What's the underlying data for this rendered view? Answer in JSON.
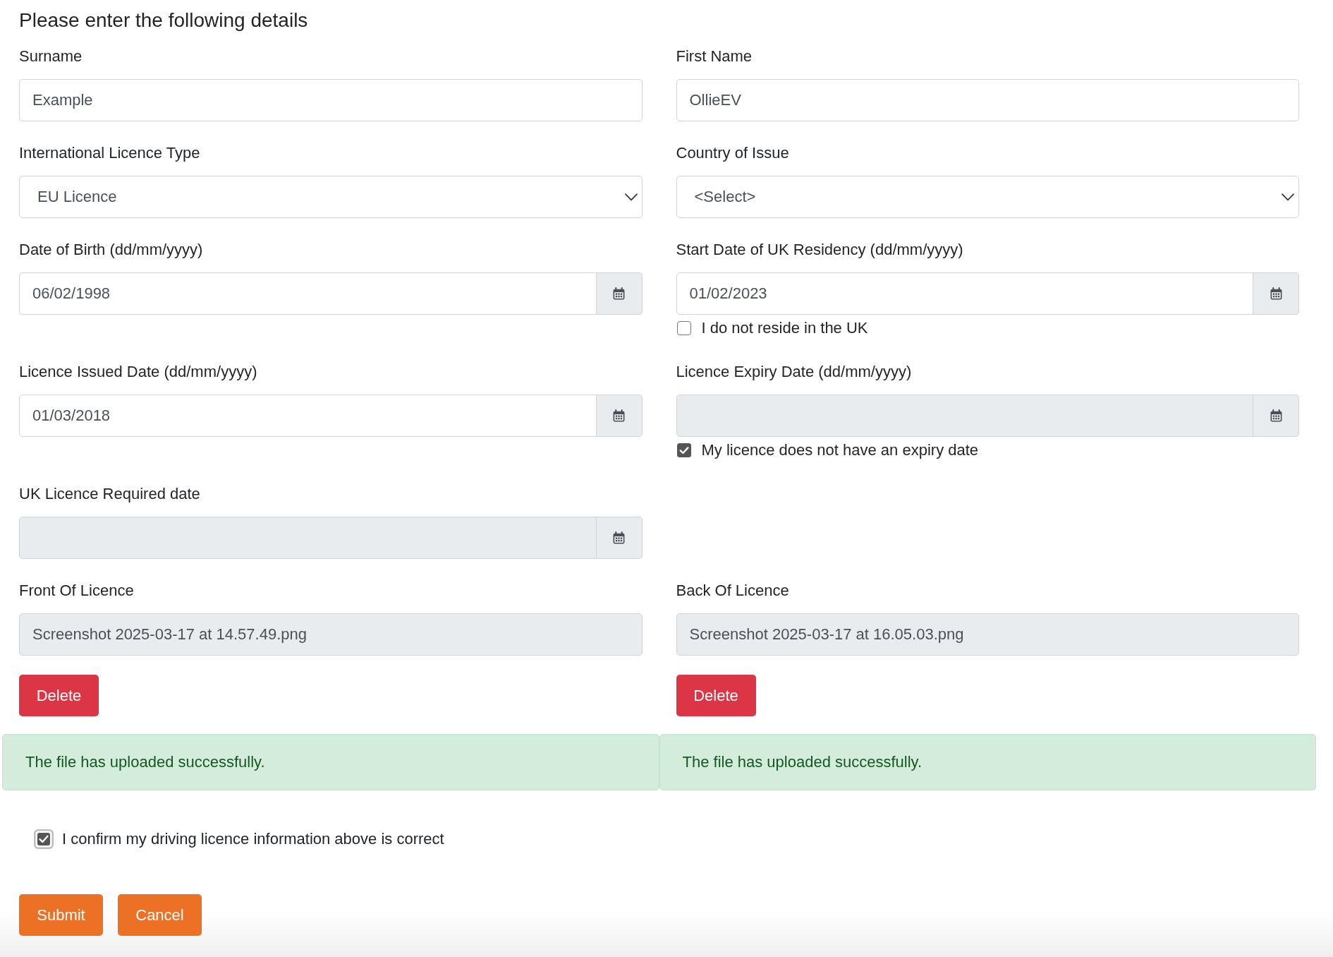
{
  "heading": "Please enter the following details",
  "rows": [
    {
      "fields": [
        {
          "kind": "text",
          "label": "Surname",
          "value": "Example"
        },
        {
          "kind": "text",
          "label": "First Name",
          "value": "OllieEV"
        }
      ]
    },
    {
      "fields": [
        {
          "kind": "select",
          "label": "International Licence Type",
          "value": "EU Licence"
        },
        {
          "kind": "select",
          "label": "Country of Issue",
          "value": "<Select>"
        }
      ]
    },
    {
      "fields": [
        {
          "kind": "date",
          "label": "Date of Birth (dd/mm/yyyy)",
          "value": "06/02/1998",
          "disabled": false
        },
        {
          "kind": "date",
          "label": "Start Date of UK Residency (dd/mm/yyyy)",
          "value": "01/02/2023",
          "disabled": false,
          "option": {
            "label": "I do not reside in the UK",
            "checked": false
          }
        }
      ]
    },
    {
      "fields": [
        {
          "kind": "date",
          "label": "Licence Issued Date (dd/mm/yyyy)",
          "value": "01/03/2018",
          "disabled": false
        },
        {
          "kind": "date",
          "label": "Licence Expiry Date (dd/mm/yyyy)",
          "disabled": true,
          "option": {
            "label": "My licence does not have an expiry date",
            "checked": true
          }
        }
      ]
    },
    {
      "fields": [
        {
          "kind": "date",
          "label": "UK Licence Required date",
          "disabled": true
        }
      ]
    },
    {
      "fields": [
        {
          "kind": "file",
          "label": "Front Of Licence",
          "value": "Screenshot 2025-03-17 at 14.57.49.png",
          "button": "Delete"
        },
        {
          "kind": "file",
          "label": "Back Of Licence",
          "value": "Screenshot 2025-03-17 at 16.05.03.png",
          "button": "Delete"
        }
      ]
    }
  ],
  "alerts": [
    {
      "kind": "success",
      "text": "The file has uploaded successfully."
    },
    {
      "kind": "success",
      "text": "The file has uploaded successfully."
    }
  ],
  "confirmation": {
    "label": "I confirm my driving licence information above is correct",
    "checked": true
  },
  "actions": [
    "Submit",
    "Cancel"
  ]
}
